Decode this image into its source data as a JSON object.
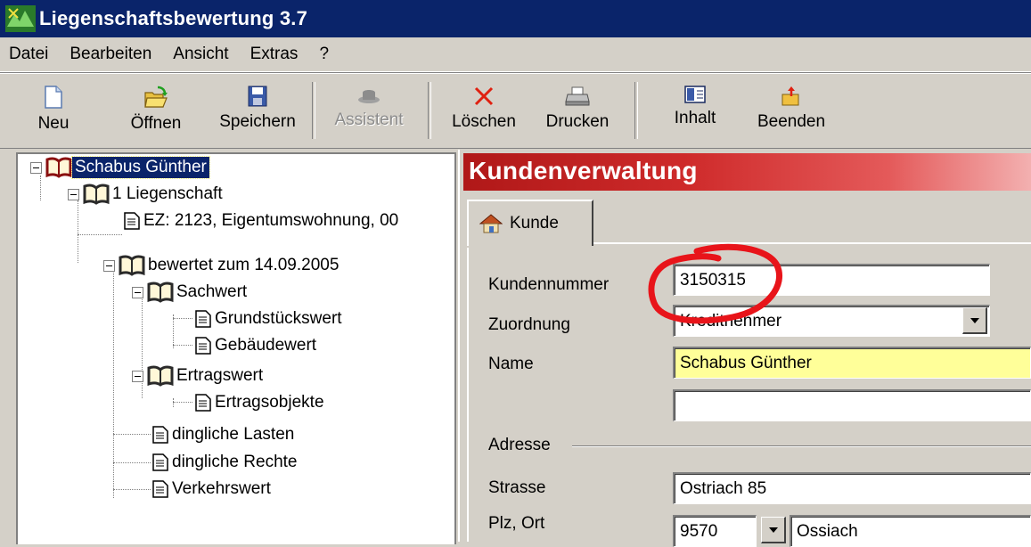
{
  "window": {
    "title": "Liegenschaftsbewertung 3.7"
  },
  "menu": {
    "items": [
      "Datei",
      "Bearbeiten",
      "Ansicht",
      "Extras",
      "?"
    ]
  },
  "toolbar": {
    "buttons": [
      {
        "label": "Neu",
        "icon": "new-document-icon",
        "enabled": true
      },
      {
        "label": "Öffnen",
        "icon": "open-folder-icon",
        "enabled": true
      },
      {
        "label": "Speichern",
        "icon": "save-disk-icon",
        "enabled": true
      },
      {
        "label": "Assistent",
        "icon": "assistant-hat-icon",
        "enabled": false
      },
      {
        "label": "Löschen",
        "icon": "delete-x-icon",
        "enabled": true
      },
      {
        "label": "Drucken",
        "icon": "printer-icon",
        "enabled": true
      },
      {
        "label": "Inhalt",
        "icon": "contents-icon",
        "enabled": true
      },
      {
        "label": "Beenden",
        "icon": "exit-icon",
        "enabled": true
      }
    ]
  },
  "tree": {
    "nodes": [
      {
        "label": "Schabus Günther",
        "type": "book",
        "selected": true
      },
      {
        "label": "1 Liegenschaft",
        "type": "book"
      },
      {
        "label": "EZ: 2123, Eigentumswohnung, 00",
        "type": "doc"
      },
      {
        "label": "bewertet zum 14.09.2005",
        "type": "book"
      },
      {
        "label": "Sachwert",
        "type": "book"
      },
      {
        "label": "Grundstückswert",
        "type": "doc"
      },
      {
        "label": "Gebäudewert",
        "type": "doc"
      },
      {
        "label": "Ertragswert",
        "type": "book"
      },
      {
        "label": "Ertragsobjekte",
        "type": "doc"
      },
      {
        "label": "dingliche Lasten",
        "type": "doc"
      },
      {
        "label": "dingliche Rechte",
        "type": "doc"
      },
      {
        "label": "Verkehrswert",
        "type": "doc"
      }
    ]
  },
  "panel": {
    "title": "Kundenverwaltung",
    "tab_label": "Kunde",
    "colors": {
      "header_red": "#cf2b2b",
      "highlight_yellow": "#ffff99",
      "annotation_red": "#e8141a"
    }
  },
  "form": {
    "kundennummer": {
      "label": "Kundennummer",
      "value": "3150315"
    },
    "zuordnung": {
      "label": "Zuordnung",
      "value": "Kreditnehmer"
    },
    "name": {
      "label": "Name",
      "value": "Schabus Günther"
    },
    "name2": {
      "value": ""
    },
    "adresse": {
      "label": "Adresse"
    },
    "strasse": {
      "label": "Strasse",
      "value": "Ostriach 85"
    },
    "plzort": {
      "label": "Plz, Ort",
      "plz": "9570",
      "ort": "Ossiach"
    }
  }
}
